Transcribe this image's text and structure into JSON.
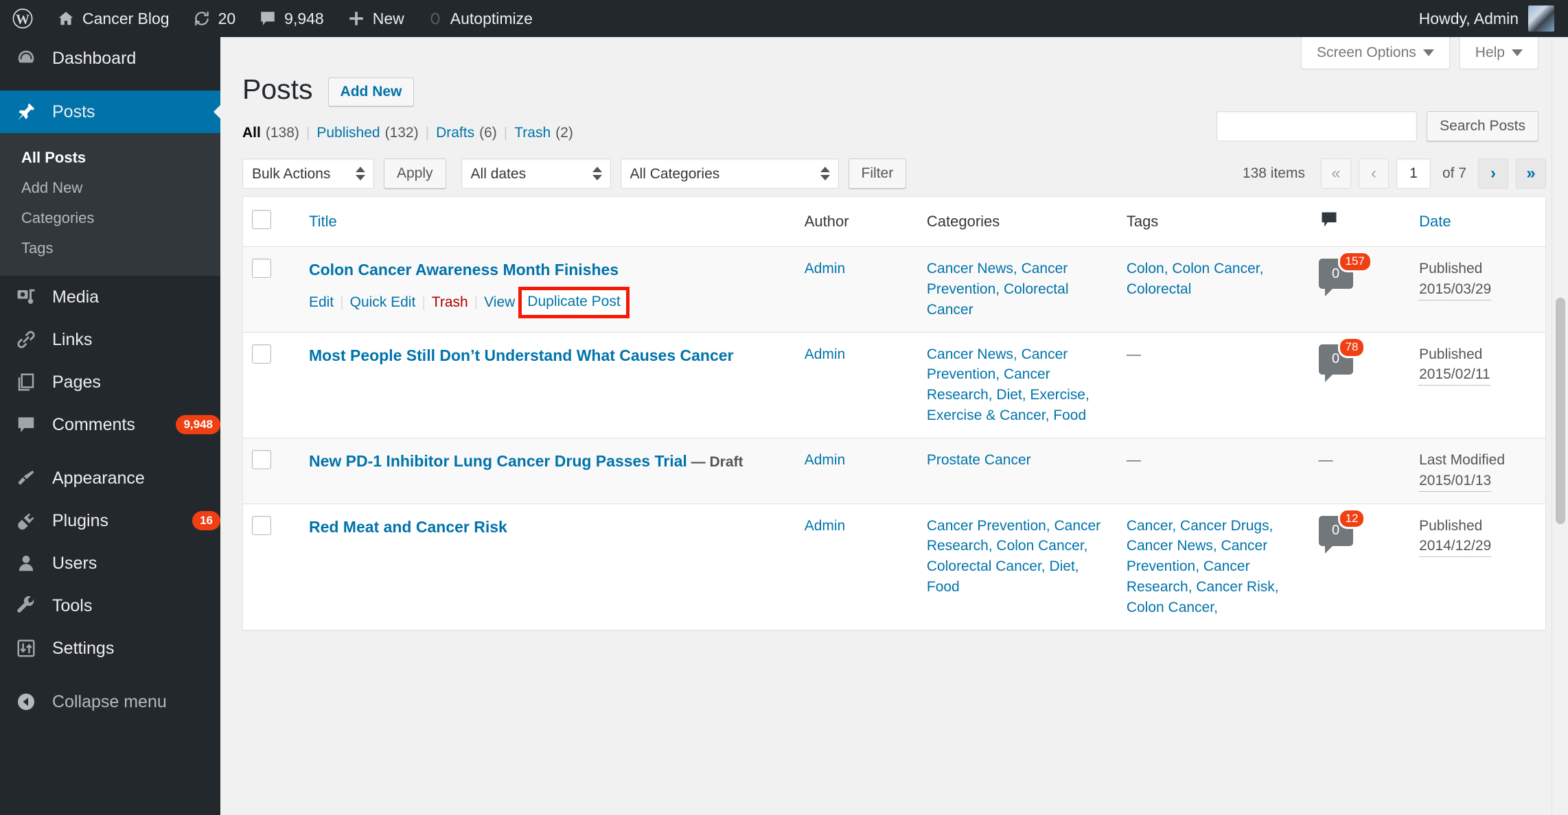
{
  "adminbar": {
    "wp_logo": "wordpress-logo-icon",
    "site_name": "Cancer Blog",
    "updates_count": "20",
    "comments_count": "9,948",
    "new_label": "New",
    "autoptimize_label": "Autoptimize",
    "howdy": "Howdy, Admin"
  },
  "sidebar": {
    "items": [
      {
        "label": "Dashboard",
        "icon": "dashboard-icon",
        "badge": ""
      },
      {
        "label": "Posts",
        "icon": "pin-icon",
        "badge": "",
        "current": true
      },
      {
        "label": "Media",
        "icon": "media-icon",
        "badge": ""
      },
      {
        "label": "Links",
        "icon": "link-icon",
        "badge": ""
      },
      {
        "label": "Pages",
        "icon": "pages-icon",
        "badge": ""
      },
      {
        "label": "Comments",
        "icon": "comment-icon",
        "badge": "9,948"
      },
      {
        "label": "Appearance",
        "icon": "brush-icon",
        "badge": ""
      },
      {
        "label": "Plugins",
        "icon": "plug-icon",
        "badge": "16"
      },
      {
        "label": "Users",
        "icon": "user-icon",
        "badge": ""
      },
      {
        "label": "Tools",
        "icon": "wrench-icon",
        "badge": ""
      },
      {
        "label": "Settings",
        "icon": "settings-icon",
        "badge": ""
      },
      {
        "label": "Collapse menu",
        "icon": "collapse-arrow-icon",
        "badge": ""
      }
    ],
    "submenu": [
      {
        "label": "All Posts",
        "current": true
      },
      {
        "label": "Add New",
        "current": false
      },
      {
        "label": "Categories",
        "current": false
      },
      {
        "label": "Tags",
        "current": false
      }
    ]
  },
  "screen_meta": {
    "screen_options": "Screen Options",
    "help": "Help"
  },
  "header": {
    "page_title": "Posts",
    "add_new": "Add New"
  },
  "search": {
    "value": "",
    "placeholder": "",
    "button": "Search Posts"
  },
  "status_links": [
    {
      "label": "All",
      "count": "(138)",
      "current": true
    },
    {
      "label": "Published",
      "count": "(132)",
      "current": false
    },
    {
      "label": "Drafts",
      "count": "(6)",
      "current": false
    },
    {
      "label": "Trash",
      "count": "(2)",
      "current": false
    }
  ],
  "tablenav": {
    "bulk_actions": "Bulk Actions",
    "apply": "Apply",
    "all_dates": "All dates",
    "all_categories": "All Categories",
    "filter": "Filter",
    "displaying_num": "138 items",
    "first_page": "«",
    "prev_page": "‹",
    "current_page": "1",
    "of_total": "of 7",
    "next_page": "›",
    "last_page": "»"
  },
  "table": {
    "columns": {
      "title": "Title",
      "author": "Author",
      "categories": "Categories",
      "tags": "Tags",
      "comments": "comment-bubble-icon",
      "date": "Date"
    },
    "rows": [
      {
        "title": "Colon Cancer Awareness Month Finishes",
        "state": "",
        "actions": {
          "edit": "Edit",
          "quick_edit": "Quick Edit",
          "trash": "Trash",
          "view": "View",
          "duplicate": "Duplicate Post"
        },
        "author": "Admin",
        "categories": "Cancer News, Cancer Prevention, Colorectal Cancer",
        "tags": "Colon, Colon Cancer, Colorectal",
        "comments_shown": "0",
        "comments_pending": "157",
        "date_status": "Published",
        "date_value": "2015/03/29",
        "highlighted": true
      },
      {
        "title": "Most People Still Don’t Understand What Causes Cancer",
        "state": "",
        "actions": null,
        "author": "Admin",
        "categories": "Cancer News, Cancer Prevention, Cancer Research, Diet, Exercise, Exercise & Cancer, Food",
        "tags": "—",
        "comments_shown": "0",
        "comments_pending": "78",
        "date_status": "Published",
        "date_value": "2015/02/11",
        "highlighted": false
      },
      {
        "title": "New PD-1 Inhibitor Lung Cancer Drug Passes Trial",
        "state": "— Draft",
        "actions": null,
        "author": "Admin",
        "categories": "Prostate Cancer",
        "tags": "—",
        "comments_shown": "",
        "comments_pending": "",
        "comments_dash": "—",
        "date_status": "Last Modified",
        "date_value": "2015/01/13",
        "highlighted": false
      },
      {
        "title": "Red Meat and Cancer Risk",
        "state": "",
        "actions": null,
        "author": "Admin",
        "categories": "Cancer Prevention, Cancer Research, Colon Cancer, Colorectal Cancer, Diet, Food",
        "tags": "Cancer, Cancer Drugs, Cancer News, Cancer Prevention, Cancer Research, Cancer Risk, Colon Cancer,",
        "comments_shown": "0",
        "comments_pending": "12",
        "date_status": "Published",
        "date_value": "2014/12/29",
        "highlighted": false
      }
    ]
  },
  "colors": {
    "admin_dark": "#23282d",
    "accent_blue": "#0073aa",
    "link_blue": "#0073aa",
    "badge_red": "#f03f12",
    "trash_red": "#a00",
    "highlight_red": "#f41a05"
  }
}
